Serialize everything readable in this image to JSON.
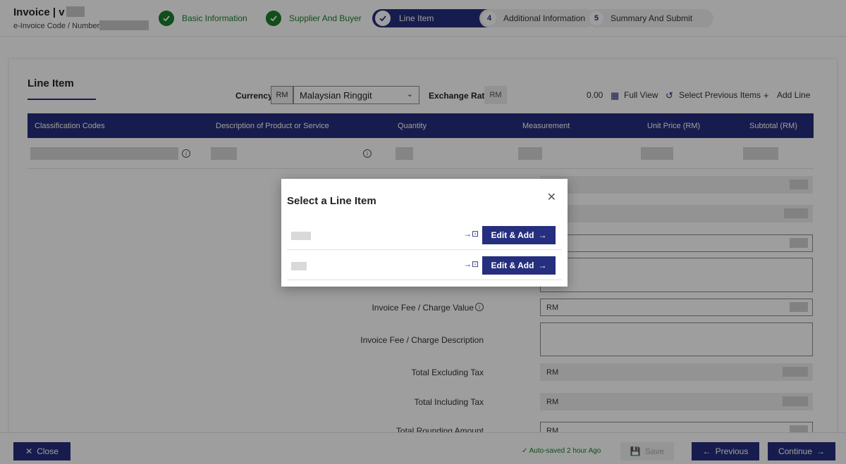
{
  "header": {
    "title_prefix": "Invoice | v",
    "subtitle": "e-Invoice Code / Number"
  },
  "steps": [
    {
      "label": "Basic Information",
      "state": "done"
    },
    {
      "label": "Supplier And Buyer",
      "state": "done"
    },
    {
      "label": "Line Item",
      "state": "active"
    },
    {
      "number": "4",
      "label": "Additional Information",
      "state": "future"
    },
    {
      "number": "5",
      "label": "Summary And Submit",
      "state": "future"
    }
  ],
  "section": {
    "title": "Line Item",
    "currency_label": "Currency",
    "currency_prefix": "RM",
    "currency_value": "Malaysian Ringgit",
    "exchange_rate_label": "Exchange Rate",
    "exchange_rate_prefix": "RM",
    "total_value": "0.00",
    "full_view": "Full View",
    "select_previous": "Select Previous Items",
    "add_line": "Add Line"
  },
  "table": {
    "headers": [
      "Classification Codes",
      "Description of Product or Service",
      "Quantity",
      "Measurement",
      "Unit Price (RM)",
      "Subtotal (RM)"
    ]
  },
  "fields": {
    "charge_value_label": "Invoice Fee / Charge Value",
    "charge_desc_label": "Invoice Fee / Charge Description",
    "total_excl_label": "Total Excluding Tax",
    "total_incl_label": "Total Including Tax",
    "rounding_label": "Total Rounding Amount",
    "currency_prefix": "RM"
  },
  "modal": {
    "title": "Select a Line Item",
    "button_label": "Edit & Add"
  },
  "footer": {
    "close_label": "Close",
    "autosave": "Auto-saved 2 hour Ago",
    "save_label": "Save",
    "previous_label": "Previous",
    "continue_label": "Continue"
  },
  "colors": {
    "primary": "#262e7e",
    "success": "#1a7f2e"
  }
}
